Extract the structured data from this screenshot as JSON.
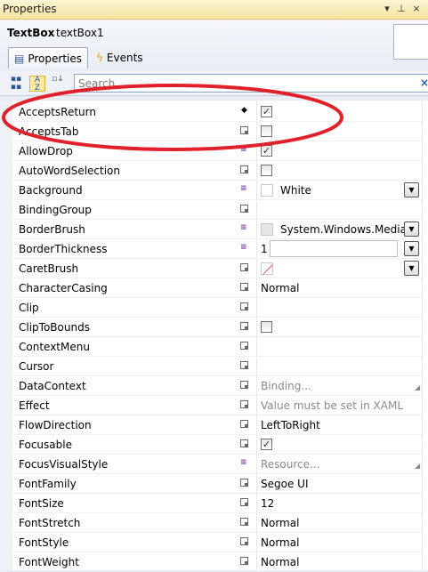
{
  "panel": {
    "title": "Properties"
  },
  "object": {
    "type": "TextBox",
    "name": "textBox1"
  },
  "tabs": [
    {
      "label": "Properties"
    },
    {
      "label": "Events"
    }
  ],
  "search": {
    "placeholder": "Search",
    "value": ""
  },
  "properties": [
    {
      "name": "AcceptsReturn",
      "marker": "diamond",
      "kind": "checkbox",
      "checked": true
    },
    {
      "name": "AcceptsTab",
      "marker": "box",
      "kind": "checkbox",
      "checked": false
    },
    {
      "name": "AllowDrop",
      "marker": "resource",
      "kind": "checkbox",
      "checked": true
    },
    {
      "name": "AutoWordSelection",
      "marker": "box",
      "kind": "checkbox",
      "checked": false
    },
    {
      "name": "Background",
      "marker": "resource",
      "kind": "brush",
      "value": "White",
      "swatch": "#ffffff",
      "dropdown": true
    },
    {
      "name": "BindingGroup",
      "marker": "box",
      "kind": "text",
      "value": ""
    },
    {
      "name": "BorderBrush",
      "marker": "resource",
      "kind": "brush",
      "value": "System.Windows.Media.L",
      "swatch": "#e6e6e6",
      "dropdown": true
    },
    {
      "name": "BorderThickness",
      "marker": "resource",
      "kind": "text",
      "value": "1",
      "dropdown": true,
      "selbox": true
    },
    {
      "name": "CaretBrush",
      "marker": "box",
      "kind": "nobrush",
      "value": "",
      "dropdown": true
    },
    {
      "name": "CharacterCasing",
      "marker": "box",
      "kind": "text",
      "value": "Normal"
    },
    {
      "name": "Clip",
      "marker": "box",
      "kind": "text",
      "value": ""
    },
    {
      "name": "ClipToBounds",
      "marker": "box",
      "kind": "checkbox",
      "checked": false
    },
    {
      "name": "ContextMenu",
      "marker": "box",
      "kind": "text",
      "value": ""
    },
    {
      "name": "Cursor",
      "marker": "box",
      "kind": "text",
      "value": ""
    },
    {
      "name": "DataContext",
      "marker": "box",
      "kind": "hint",
      "value": "Binding...",
      "triangle": true
    },
    {
      "name": "Effect",
      "marker": "box",
      "kind": "hint",
      "value": "Value must be set in XAML"
    },
    {
      "name": "FlowDirection",
      "marker": "box",
      "kind": "text",
      "value": "LeftToRight"
    },
    {
      "name": "Focusable",
      "marker": "box",
      "kind": "checkbox",
      "checked": true
    },
    {
      "name": "FocusVisualStyle",
      "marker": "resource",
      "kind": "hint",
      "value": "Resource...",
      "triangle": true
    },
    {
      "name": "FontFamily",
      "marker": "box",
      "kind": "text",
      "value": "Segoe UI"
    },
    {
      "name": "FontSize",
      "marker": "box",
      "kind": "text",
      "value": "12"
    },
    {
      "name": "FontStretch",
      "marker": "box",
      "kind": "text",
      "value": "Normal"
    },
    {
      "name": "FontStyle",
      "marker": "box",
      "kind": "text",
      "value": "Normal"
    },
    {
      "name": "FontWeight",
      "marker": "box",
      "kind": "text",
      "value": "Normal"
    }
  ],
  "annotation": {
    "color": "#e0202a"
  },
  "icons": {
    "pin": "pin-icon",
    "close": "close-icon",
    "dropdown": "dropdown-arrow-icon",
    "categorized": "categorized-sort-icon",
    "alphabetical": "alphabetical-sort-icon",
    "lightning": "lightning-icon",
    "properties_tab": "properties-tab-icon",
    "search_clear": "clear-search-icon"
  },
  "colors": {
    "title_bar": "#f5e3a0",
    "accent": "#1f57b5"
  }
}
